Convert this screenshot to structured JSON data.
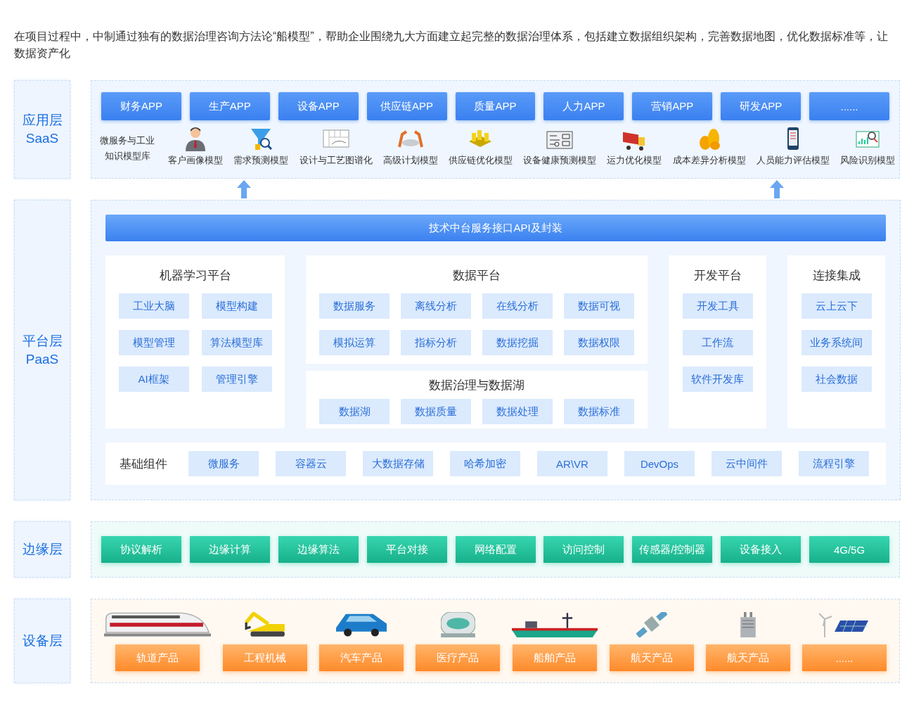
{
  "intro": "在项目过程中，中制通过独有的数据治理咨询方法论“船模型”，帮助企业围绕九大方面建立起完整的数据治理体系，包括建立数据组织架构，完善数据地图，优化数据标准等，让数据资产化",
  "saas": {
    "label": "应用层",
    "label_en": "SaaS",
    "apps": [
      "财务APP",
      "生产APP",
      "设备APP",
      "供应链APP",
      "质量APP",
      "人力APP",
      "营销APP",
      "研发APP",
      "......"
    ],
    "library": "微服务与工业知识模型库",
    "models": [
      "客户画像模型",
      "需求预测模型",
      "设计与工艺图谱化",
      "高级计划模型",
      "供应链优化模型",
      "设备健康预测模型",
      "运力优化模型",
      "成本差异分析模型",
      "人员能力评估模型",
      "风险识别模型"
    ]
  },
  "paas": {
    "label": "平台层",
    "label_en": "PaaS",
    "api_bar": "技术中台服务接口API及封装",
    "ml": {
      "title": "机器学习平台",
      "items": [
        "工业大脑",
        "模型构建",
        "模型管理",
        "算法模型库",
        "AI框架",
        "管理引擎"
      ]
    },
    "data": {
      "title": "数据平台",
      "items": [
        "数据服务",
        "离线分析",
        "在线分析",
        "数据可视",
        "模拟运算",
        "指标分析",
        "数据挖掘",
        "数据权限"
      ]
    },
    "governance": {
      "title": "数据治理与数据湖",
      "items": [
        "数据湖",
        "数据质量",
        "数据处理",
        "数据标准"
      ]
    },
    "dev": {
      "title": "开发平台",
      "items": [
        "开发工具",
        "工作流",
        "软件开发库"
      ]
    },
    "connect": {
      "title": "连接集成",
      "items": [
        "云上云下",
        "业务系统间",
        "社会数据"
      ]
    },
    "base": {
      "title": "基础组件",
      "items": [
        "微服务",
        "容器云",
        "大数据存储",
        "哈希加密",
        "AR\\VR",
        "DevOps",
        "云中间件",
        "流程引擎"
      ]
    }
  },
  "edge": {
    "label": "边缘层",
    "items": [
      "协议解析",
      "边缘计算",
      "边缘算法",
      "平台对接",
      "网络配置",
      "访问控制",
      "传感器/控制器",
      "设备接入",
      "4G/5G"
    ]
  },
  "device": {
    "label": "设备层",
    "items": [
      "轨道产品",
      "工程机械",
      "汽车产品",
      "医疗产品",
      "船舶产品",
      "航天产品",
      "航天产品",
      "......"
    ]
  }
}
